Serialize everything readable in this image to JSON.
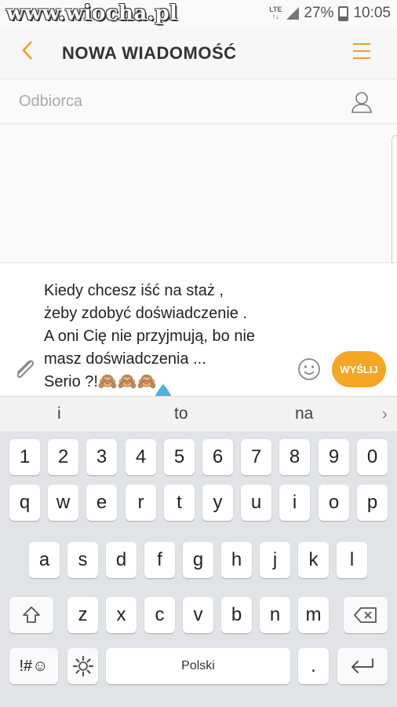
{
  "status_bar": {
    "watermark": "www.wiocha.pl",
    "network": "LTE",
    "battery": "27%",
    "time": "10:05"
  },
  "header": {
    "title": "NOWA WIADOMOŚĆ"
  },
  "recipient": {
    "placeholder": "Odbiorca"
  },
  "compose": {
    "message": "Kiedy  chcesz iść na staż ,\nżeby zdobyć doświadczenie .\nA oni Cię nie przyjmują, bo nie\nmasz doświadczenia ...\nSerio ?!🙈🙈🙈",
    "send_label": "WYŚLIJ"
  },
  "suggestions": [
    "i",
    "to",
    "na"
  ],
  "keyboard": {
    "row1": [
      "1",
      "2",
      "3",
      "4",
      "5",
      "6",
      "7",
      "8",
      "9",
      "0"
    ],
    "row2": [
      "q",
      "w",
      "e",
      "r",
      "t",
      "y",
      "u",
      "i",
      "o",
      "p"
    ],
    "row3": [
      "a",
      "s",
      "d",
      "f",
      "g",
      "h",
      "j",
      "k",
      "l"
    ],
    "row4": [
      "z",
      "x",
      "c",
      "v",
      "b",
      "n",
      "m"
    ],
    "symbols_label": "!#☺",
    "space_label": "Polski",
    "period_label": "."
  },
  "colors": {
    "accent": "#f5a623",
    "keyboard_bg": "#e1e3e6"
  }
}
